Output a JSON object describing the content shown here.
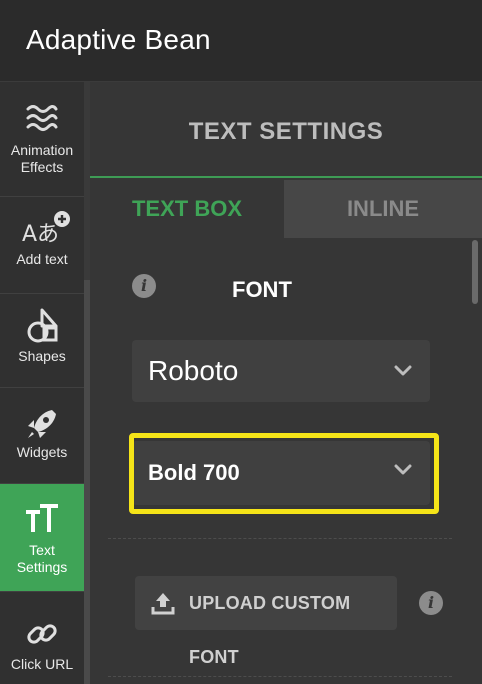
{
  "app": {
    "title": "Adaptive Bean"
  },
  "sidebar": {
    "items": [
      {
        "label_line1": "Animation",
        "label_line2": "Effects",
        "icon": "waves-icon"
      },
      {
        "label_line1": "Add text",
        "icon": "add-text-icon"
      },
      {
        "label_line1": "Shapes",
        "icon": "shapes-icon"
      },
      {
        "label_line1": "Widgets",
        "icon": "rocket-icon"
      },
      {
        "label_line1": "Text",
        "label_line2": "Settings",
        "icon": "text-settings-icon",
        "active": true
      },
      {
        "label_line1": "Click URL",
        "icon": "link-icon"
      }
    ]
  },
  "panel": {
    "title": "TEXT SETTINGS",
    "tabs": {
      "textbox": "TEXT BOX",
      "inline": "INLINE"
    },
    "font_section": {
      "label": "FONT",
      "info_glyph": "i",
      "font_family": "Roboto",
      "font_weight": "Bold 700"
    },
    "upload": {
      "label": "UPLOAD CUSTOM FONT",
      "info_glyph": "i"
    }
  },
  "colors": {
    "accent_green": "#3fa457",
    "highlight_yellow": "#f5e418",
    "background": "#363636"
  }
}
